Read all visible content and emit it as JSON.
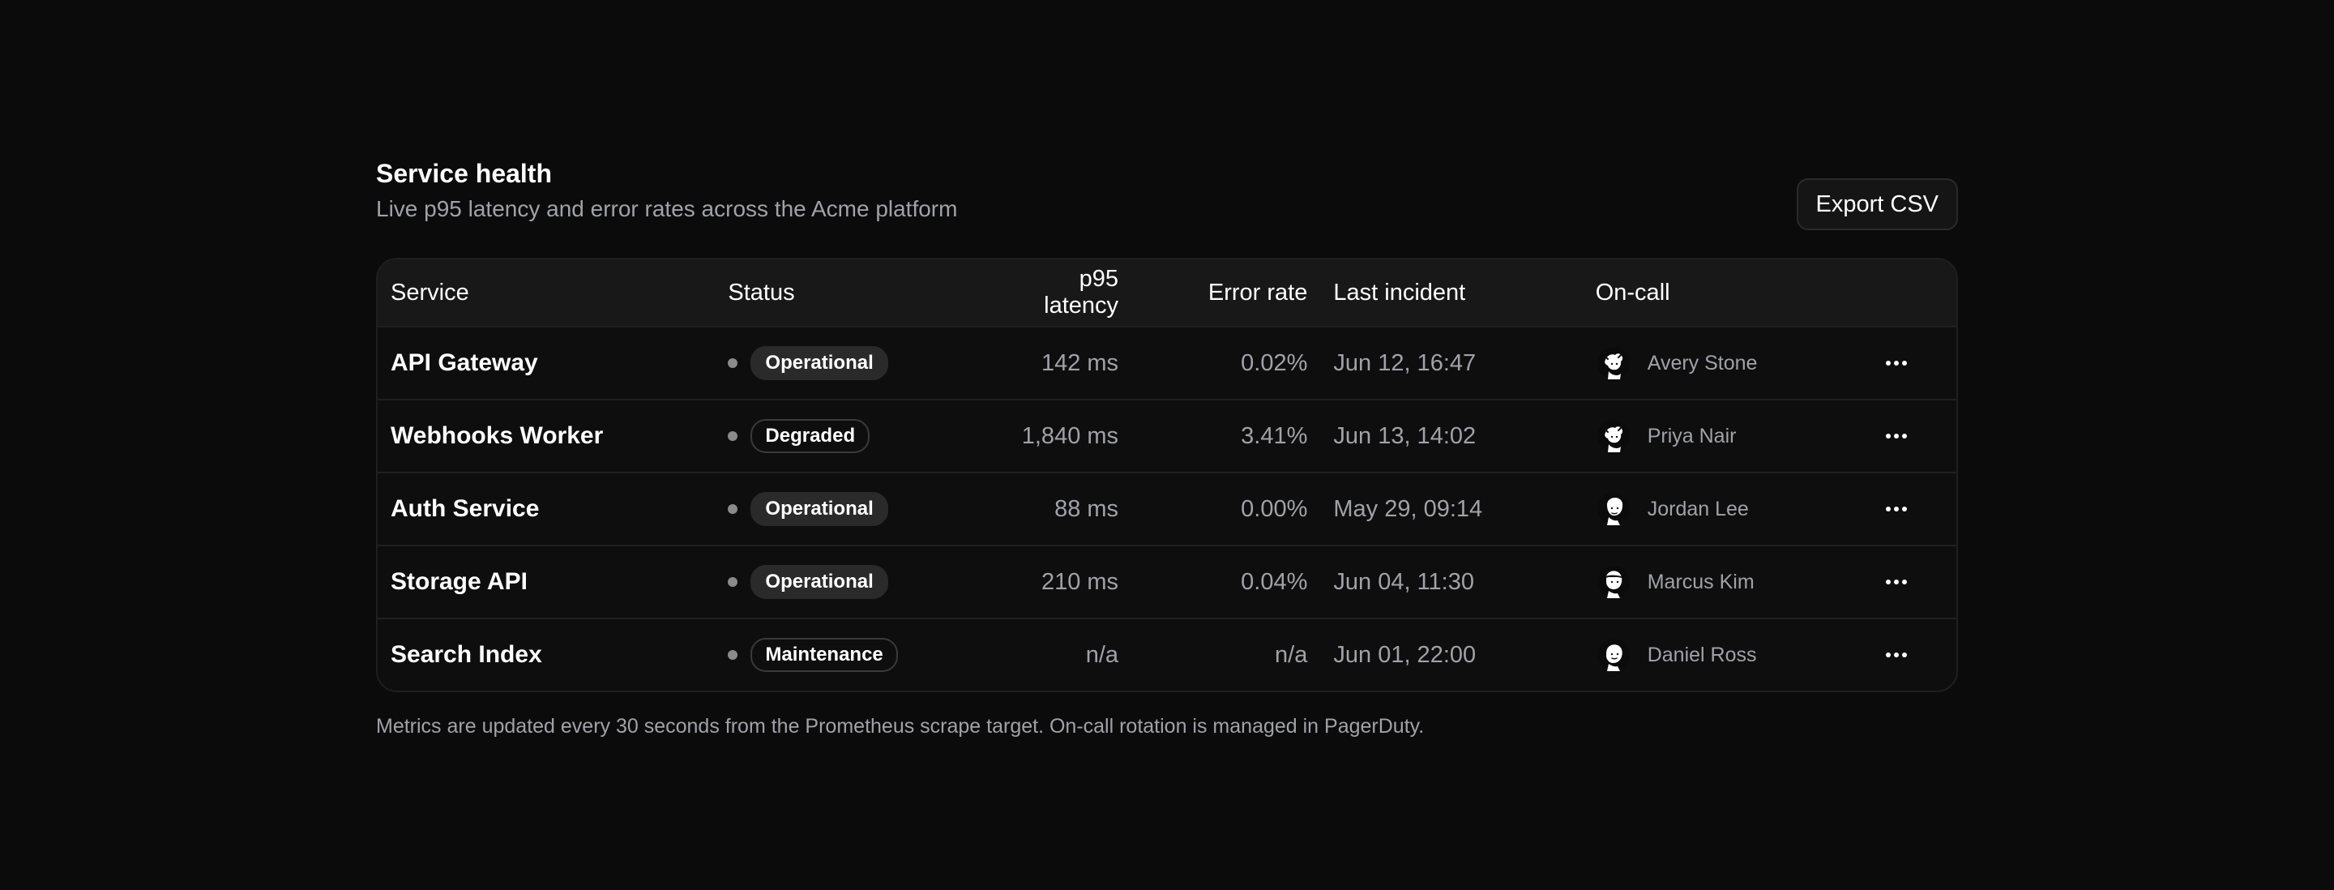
{
  "header": {
    "title": "Service health",
    "subtitle": "Live p95 latency and error rates across the Acme platform",
    "export_label": "Export CSV"
  },
  "table": {
    "columns": {
      "service": "Service",
      "status": "Status",
      "latency": "p95 latency",
      "error_rate": "Error rate",
      "last_incident": "Last incident",
      "on_call": "On-call"
    },
    "rows": [
      {
        "service": "API Gateway",
        "status": "Operational",
        "status_style": "filled",
        "latency": "142 ms",
        "error_rate": "0.02%",
        "last_incident": "Jun 12, 16:47",
        "on_call": "Avery Stone",
        "avatar_icon": "avatar-icon"
      },
      {
        "service": "Webhooks Worker",
        "status": "Degraded",
        "status_style": "outlined",
        "latency": "1,840 ms",
        "error_rate": "3.41%",
        "last_incident": "Jun 13, 14:02",
        "on_call": "Priya Nair",
        "avatar_icon": "avatar-icon"
      },
      {
        "service": "Auth Service",
        "status": "Operational",
        "status_style": "filled",
        "latency": "88 ms",
        "error_rate": "0.00%",
        "last_incident": "May 29, 09:14",
        "on_call": "Jordan Lee",
        "avatar_icon": "avatar-icon"
      },
      {
        "service": "Storage API",
        "status": "Operational",
        "status_style": "filled",
        "latency": "210 ms",
        "error_rate": "0.04%",
        "last_incident": "Jun 04, 11:30",
        "on_call": "Marcus Kim",
        "avatar_icon": "avatar-icon"
      },
      {
        "service": "Search Index",
        "status": "Maintenance",
        "status_style": "outlined",
        "latency": "n/a",
        "error_rate": "n/a",
        "last_incident": "Jun 01, 22:00",
        "on_call": "Daniel Ross",
        "avatar_icon": "avatar-icon"
      }
    ]
  },
  "footer": {
    "note": "Metrics are updated every 30 seconds from the Prometheus scrape target. On-call rotation is managed in PagerDuty."
  },
  "colors": {
    "background": "#0b0b0b",
    "table_header_bg": "#181818",
    "muted_text": "#a1a1aa",
    "status_dot": "#8b8b8b"
  }
}
